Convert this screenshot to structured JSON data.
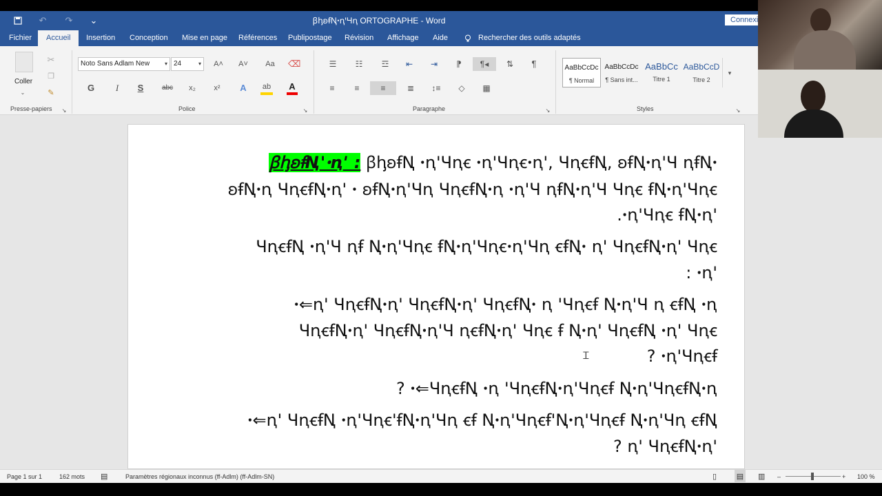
{
  "window": {
    "title": "ꞵꞕꞝꞙꞐꞏꞑꞌꞍꞑ ORTOGRAPHE - Word",
    "connexion_label": "Connexio",
    "quick_access": {
      "save": "💾",
      "undo": "↶",
      "redo": "↷",
      "customize": "⌄"
    }
  },
  "tabs": [
    {
      "label": "Fichier"
    },
    {
      "label": "Accueil",
      "active": true
    },
    {
      "label": "Insertion"
    },
    {
      "label": "Conception"
    },
    {
      "label": "Mise en page"
    },
    {
      "label": "Références"
    },
    {
      "label": "Publipostage"
    },
    {
      "label": "Révision"
    },
    {
      "label": "Affichage"
    },
    {
      "label": "Aide"
    },
    {
      "label": "Rechercher des outils adaptés"
    }
  ],
  "ribbon": {
    "clipboard": {
      "group_label": "Presse-papiers",
      "paste_label": "Coller"
    },
    "font": {
      "group_label": "Police",
      "font_name": "Noto Sans Adlam New",
      "font_size": "24",
      "bold": "G",
      "italic": "I",
      "underline": "S",
      "strike": "abc",
      "subscript": "x₂",
      "superscript": "x²",
      "grow": "A˄",
      "shrink": "A˅",
      "case": "Aa",
      "font_color": "A"
    },
    "paragraph": {
      "group_label": "Paragraphe",
      "pilcrow": "¶"
    },
    "styles": {
      "group_label": "Styles",
      "items": [
        {
          "sample": "AaBbCcDc",
          "name": "¶ Normal"
        },
        {
          "sample": "AaBbCcDc",
          "name": "¶ Sans int..."
        },
        {
          "sample": "AaBbCc",
          "name": "Titre 1"
        },
        {
          "sample": "AaBbCcD",
          "name": "Titre 2"
        }
      ]
    }
  },
  "document": {
    "heading": "ꞵꞕꞝꞙꞐ'ꞏꞑꞌ :",
    "paragraphs": [
      "ꞵꞕꞝꞙꞐ ꞏꞑꞌꞍꞑꞓ ꞏꞑꞌꞍꞑꞓꞏꞑꞌ, ꞍꞑꞓꞙꞐ, ꞝꞙꞐꞏꞑꞌꞍ ꞑꞙꞐꞏ",
      "ꞝꞙꞐꞏꞑ ꞍꞑꞓꞙꞐꞏꞑꞌ ꞏ ꞝꞙꞐꞏꞑꞌꞍꞑ ꞍꞑꞓꞙꞐꞏꞑ ꞏꞑꞌꞍ ꞑꞙꞐꞏꞑꞌꞍ Ɥꞑꞓ ꞙꞐꞏꞑꞌꞍꞑꞓ",
      "ꞏꞑꞌꞍꞑꞓ ꞙꞐꞏꞑꞌ.",
      "ꞍꞑꞓꞙꞐ ꞏꞑꞌꞍ ꞑꞙ ꞐꞏꞑꞌꞍꞑꞓ ꞙꞐꞏꞑꞌꞍꞑꞓꞏꞑꞌꞍꞑ ꞓꞙꞐꞏ ꞑꞌ ꞍꞑꞓꞙꞐꞏꞑꞌ Ɥꞑꞓ",
      "ꞏꞑꞌ :",
      "ꞏ⇐ꞑꞌ ꞍꞑꞓꞙꞐꞏꞑꞌ ꞍꞑꞓꞙꞐꞏꞑꞌ ꞍꞑꞓꞙꞐꞏ ꞑ ꞌꞍꞑꞓꞙ ꞐꞏꞑꞌꞍ ꞑ ꞓꞙꞐ ꞏꞑ",
      "ꞍꞑꞓꞙꞐꞏꞑꞌ ꞍꞑꞓꞙꞐꞏꞑꞌꞍ ꞑꞓꞙꞐꞏꞑꞌ Ɥꞑꞓ ꞙ Ꞑꞏꞑꞌ ꞍꞑꞓꞙꞐ ꞏꞑꞌ Ɥꞑꞓ",
      "ꞏꞑꞌꞍꞑꞓꞙ ?",
      "ꞏ⇐ꞍꞑꞓꞙꞐ ꞏꞑ ꞌꞍꞑꞓꞙꞐꞏꞑꞌꞍꞑꞓꞙ ꞐꞏꞑꞌꞍꞑꞓꞙꞐꞏꞑ ?",
      "ꞏ⇐ꞑꞌ ꞍꞑꞓꞙꞐ ꞏꞑꞌꞍꞑꞓ'ꞙꞐꞏꞑꞌꞍꞑ ꞓꞙ ꞐꞏꞑꞌꞍꞑꞓꞙ'ꞐꞏꞑꞌꞍꞑꞓꞙ ꞐꞏꞑꞌꞍꞑ ꞓꞙꞐ",
      "ꞑꞌ ꞍꞑꞓꞙꞐꞏꞑꞌ ?"
    ]
  },
  "status": {
    "page": "Page 1 sur 1",
    "words": "162 mots",
    "language": "Paramètres régionaux inconnus (ff-Adlm) (ff-Adlm-SN)",
    "zoom": "100 %",
    "zoom_minus": "–",
    "zoom_plus": "+"
  }
}
